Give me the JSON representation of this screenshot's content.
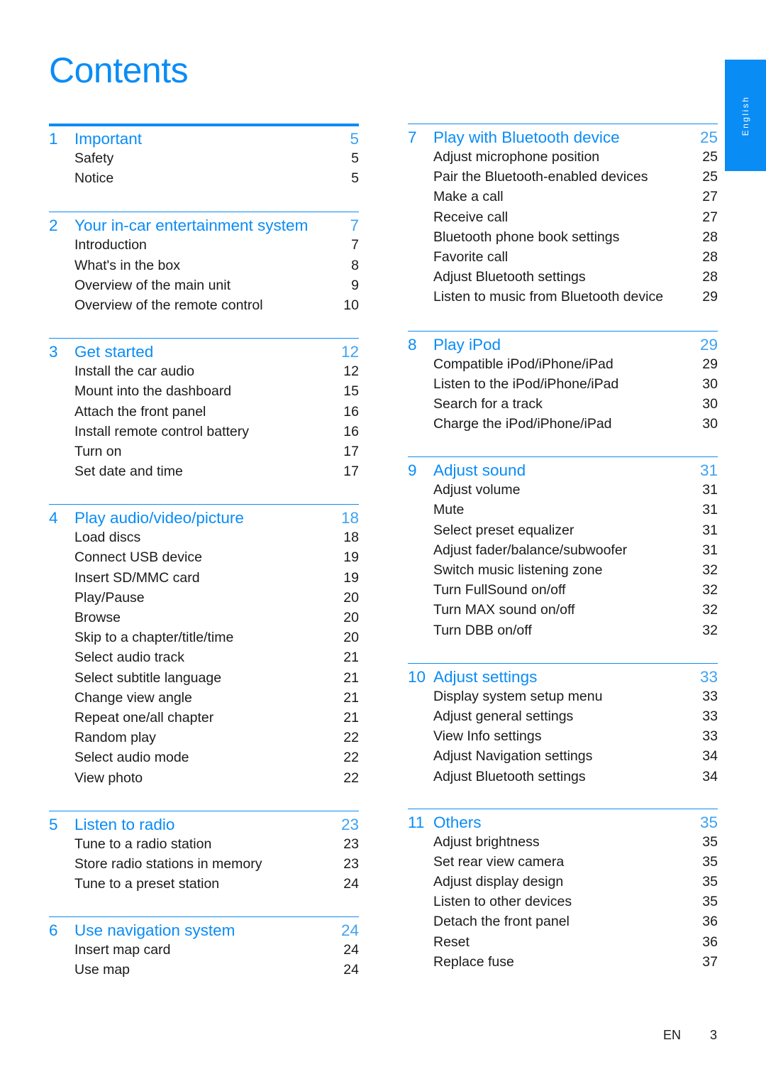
{
  "page": {
    "title": "Contents",
    "language_tab": "English",
    "footer": {
      "lang": "EN",
      "page_number": "3"
    },
    "accent_color": "#0a8cf5"
  },
  "left_column": [
    {
      "num": "1",
      "title": "Important",
      "page": "5",
      "entries": [
        {
          "title": "Safety",
          "page": "5"
        },
        {
          "title": "Notice",
          "page": "5"
        }
      ]
    },
    {
      "num": "2",
      "title": "Your in-car entertainment system",
      "page": "7",
      "entries": [
        {
          "title": "Introduction",
          "page": "7"
        },
        {
          "title": "What's in the box",
          "page": "8"
        },
        {
          "title": "Overview of the main unit",
          "page": "9"
        },
        {
          "title": "Overview of the remote control",
          "page": "10"
        }
      ]
    },
    {
      "num": "3",
      "title": "Get started",
      "page": "12",
      "entries": [
        {
          "title": "Install the car audio",
          "page": "12"
        },
        {
          "title": "Mount into the dashboard",
          "page": "15"
        },
        {
          "title": "Attach the front panel",
          "page": "16"
        },
        {
          "title": "Install remote control battery",
          "page": "16"
        },
        {
          "title": "Turn on",
          "page": "17"
        },
        {
          "title": "Set date and time",
          "page": "17"
        }
      ]
    },
    {
      "num": "4",
      "title": "Play audio/video/picture",
      "page": "18",
      "entries": [
        {
          "title": "Load discs",
          "page": "18"
        },
        {
          "title": "Connect USB device",
          "page": "19"
        },
        {
          "title": "Insert SD/MMC card",
          "page": "19"
        },
        {
          "title": "Play/Pause",
          "page": "20"
        },
        {
          "title": "Browse",
          "page": "20"
        },
        {
          "title": "Skip to a chapter/title/time",
          "page": "20"
        },
        {
          "title": "Select audio track",
          "page": "21"
        },
        {
          "title": "Select subtitle language",
          "page": "21"
        },
        {
          "title": "Change view angle",
          "page": "21"
        },
        {
          "title": "Repeat one/all chapter",
          "page": "21"
        },
        {
          "title": "Random play",
          "page": "22"
        },
        {
          "title": "Select audio mode",
          "page": "22"
        },
        {
          "title": "View photo",
          "page": "22"
        }
      ]
    },
    {
      "num": "5",
      "title": "Listen to radio",
      "page": "23",
      "entries": [
        {
          "title": "Tune to a radio station",
          "page": "23"
        },
        {
          "title": "Store radio stations in memory",
          "page": "23"
        },
        {
          "title": "Tune to a preset station",
          "page": "24"
        }
      ]
    },
    {
      "num": "6",
      "title": "Use navigation system",
      "page": "24",
      "entries": [
        {
          "title": "Insert map card",
          "page": "24"
        },
        {
          "title": "Use map",
          "page": "24"
        }
      ]
    }
  ],
  "right_column": [
    {
      "num": "7",
      "title": "Play with Bluetooth device",
      "page": "25",
      "entries": [
        {
          "title": "Adjust microphone position",
          "page": "25"
        },
        {
          "title": "Pair the Bluetooth-enabled devices",
          "page": "25"
        },
        {
          "title": "Make a call",
          "page": "27"
        },
        {
          "title": "Receive call",
          "page": "27"
        },
        {
          "title": "Bluetooth phone book settings",
          "page": "28"
        },
        {
          "title": "Favorite call",
          "page": "28"
        },
        {
          "title": "Adjust Bluetooth settings",
          "page": "28"
        },
        {
          "title": "Listen to music from Bluetooth device",
          "page": "29"
        }
      ]
    },
    {
      "num": "8",
      "title": "Play iPod",
      "page": "29",
      "entries": [
        {
          "title": "Compatible iPod/iPhone/iPad",
          "page": "29"
        },
        {
          "title": "Listen to the iPod/iPhone/iPad",
          "page": "30"
        },
        {
          "title": "Search for a track",
          "page": "30"
        },
        {
          "title": "Charge the iPod/iPhone/iPad",
          "page": "30"
        }
      ]
    },
    {
      "num": "9",
      "title": "Adjust sound",
      "page": "31",
      "entries": [
        {
          "title": "Adjust volume",
          "page": "31"
        },
        {
          "title": "Mute",
          "page": "31"
        },
        {
          "title": "Select preset equalizer",
          "page": "31"
        },
        {
          "title": "Adjust fader/balance/subwoofer",
          "page": "31"
        },
        {
          "title": "Switch music listening zone",
          "page": "32"
        },
        {
          "title": "Turn FullSound on/off",
          "page": "32"
        },
        {
          "title": "Turn MAX sound on/off",
          "page": "32"
        },
        {
          "title": "Turn DBB on/off",
          "page": "32"
        }
      ]
    },
    {
      "num": "10",
      "title": "Adjust settings",
      "page": "33",
      "entries": [
        {
          "title": "Display system setup menu",
          "page": "33"
        },
        {
          "title": "Adjust general settings",
          "page": "33"
        },
        {
          "title": "View Info settings",
          "page": "33"
        },
        {
          "title": "Adjust Navigation settings",
          "page": "34"
        },
        {
          "title": "Adjust Bluetooth settings",
          "page": "34"
        }
      ]
    },
    {
      "num": "11",
      "title": "Others",
      "page": "35",
      "entries": [
        {
          "title": "Adjust brightness",
          "page": "35"
        },
        {
          "title": "Set rear view camera",
          "page": "35"
        },
        {
          "title": "Adjust display design",
          "page": "35"
        },
        {
          "title": "Listen to other devices",
          "page": "35"
        },
        {
          "title": "Detach the front panel",
          "page": "36"
        },
        {
          "title": "Reset",
          "page": "36"
        },
        {
          "title": "Replace fuse",
          "page": "37"
        }
      ]
    }
  ]
}
